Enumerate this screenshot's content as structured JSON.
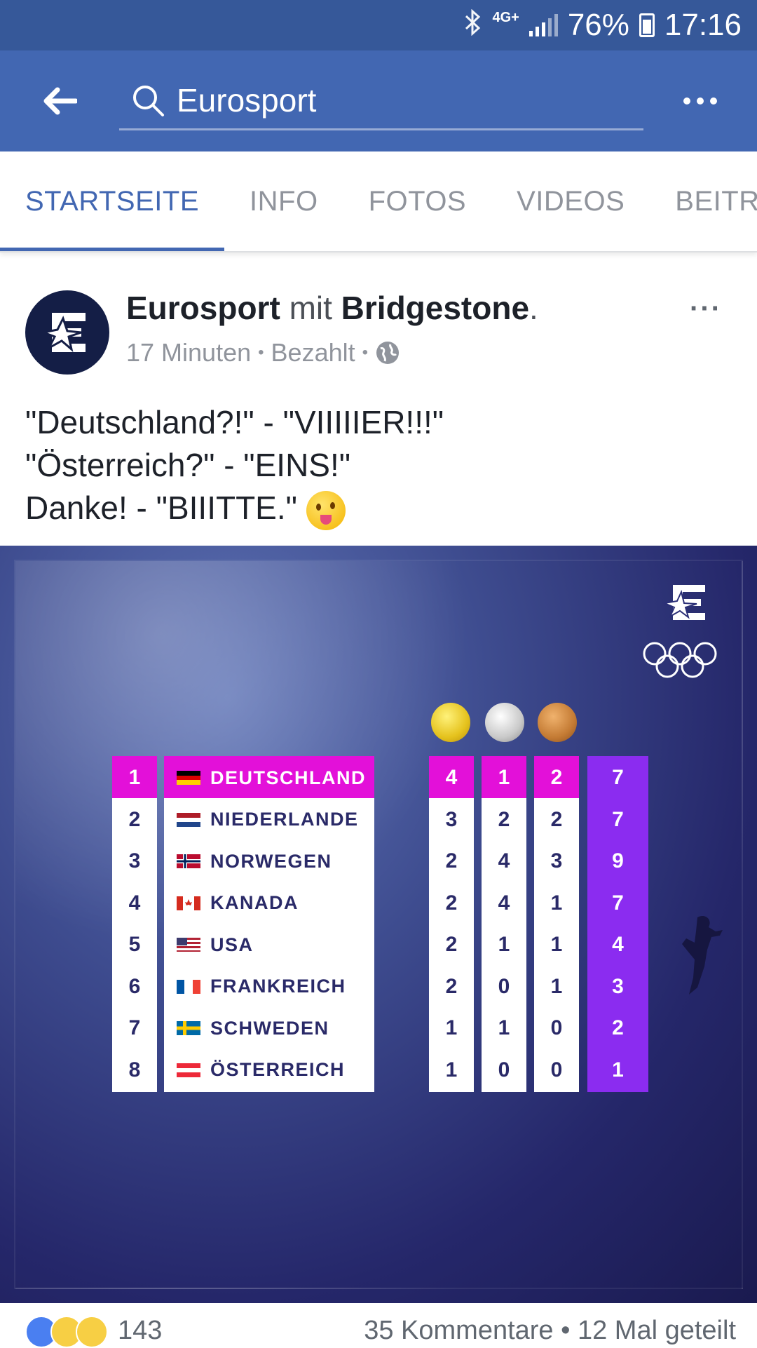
{
  "status": {
    "network": "4G+",
    "battery": "76%",
    "time": "17:16",
    "bluetooth_icon": "bluetooth-icon",
    "signal_icon": "signal-icon",
    "battery_icon": "battery-icon"
  },
  "appbar": {
    "search_value": "Eurosport",
    "back_icon": "arrow-left-icon",
    "search_icon": "search-icon",
    "more_icon": "more-horizontal-icon",
    "color": "#4267b2"
  },
  "tabs": [
    {
      "label": "STARTSEITE",
      "active": true
    },
    {
      "label": "INFO",
      "active": false
    },
    {
      "label": "FOTOS",
      "active": false
    },
    {
      "label": "VIDEOS",
      "active": false
    },
    {
      "label": "BEITRÄGE",
      "active": false
    }
  ],
  "post": {
    "author": "Eurosport",
    "with": "mit",
    "partner": "Bridgestone",
    "dot": ".",
    "time": "17 Minuten",
    "sep1": "•",
    "sponsored": "Bezahlt",
    "sep2": "•",
    "privacy_icon": "globe-icon",
    "more": "···",
    "lines": [
      "\"Deutschland?!\" - \"VIIIIIER!!!\"",
      "\"Österreich?\" - \"EINS!\"",
      "Danke! - \"BIIITTE.\""
    ],
    "emoji": "winking-face-with-tongue"
  },
  "medal_table": {
    "colors": {
      "leader": "#e310d9",
      "total": "#8b2cf0",
      "background": "#25276a"
    },
    "medal_icons": [
      "gold-medal-icon",
      "silver-medal-icon",
      "bronze-medal-icon"
    ],
    "rows": [
      {
        "rank": "1",
        "country": "DEUTSCHLAND",
        "flag": "de",
        "gold": "4",
        "silver": "1",
        "bronze": "2",
        "total": "7"
      },
      {
        "rank": "2",
        "country": "NIEDERLANDE",
        "flag": "nl",
        "gold": "3",
        "silver": "2",
        "bronze": "2",
        "total": "7"
      },
      {
        "rank": "3",
        "country": "NORWEGEN",
        "flag": "no",
        "gold": "2",
        "silver": "4",
        "bronze": "3",
        "total": "9"
      },
      {
        "rank": "4",
        "country": "KANADA",
        "flag": "ca",
        "gold": "2",
        "silver": "4",
        "bronze": "1",
        "total": "7"
      },
      {
        "rank": "5",
        "country": "USA",
        "flag": "us",
        "gold": "2",
        "silver": "1",
        "bronze": "1",
        "total": "4"
      },
      {
        "rank": "6",
        "country": "FRANKREICH",
        "flag": "fr",
        "gold": "2",
        "silver": "0",
        "bronze": "1",
        "total": "3"
      },
      {
        "rank": "7",
        "country": "SCHWEDEN",
        "flag": "se",
        "gold": "1",
        "silver": "1",
        "bronze": "0",
        "total": "2"
      },
      {
        "rank": "8",
        "country": "ÖSTERREICH",
        "flag": "at",
        "gold": "1",
        "silver": "0",
        "bronze": "0",
        "total": "1"
      }
    ]
  },
  "footer": {
    "reaction_count": "143",
    "comments_shares": "35 Kommentare • 12 Mal geteilt"
  }
}
